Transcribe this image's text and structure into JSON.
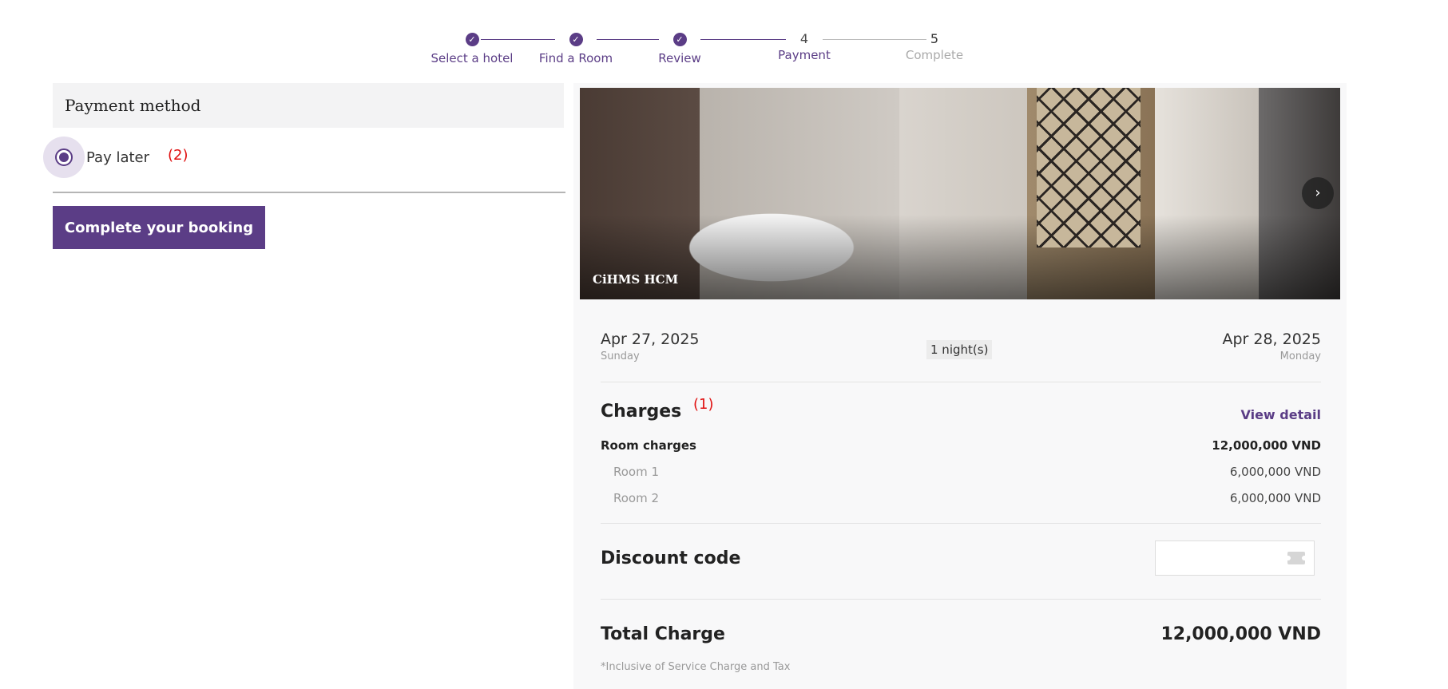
{
  "stepper": {
    "steps": [
      {
        "number": "",
        "label": "Select a hotel",
        "state": "done"
      },
      {
        "number": "",
        "label": "Find a Room",
        "state": "done"
      },
      {
        "number": "",
        "label": "Review",
        "state": "done"
      },
      {
        "number": "4",
        "label": "Payment",
        "state": "current"
      },
      {
        "number": "5",
        "label": "Complete",
        "state": "upcoming"
      }
    ]
  },
  "payment": {
    "title": "Payment method",
    "option_label": "Pay later",
    "option_selected": true,
    "annotation": "(2)",
    "button_label": "Complete your booking"
  },
  "summary": {
    "hotel_name": "CiHMS HCM",
    "check_in_date": "Apr 27, 2025",
    "check_in_day": "Sunday",
    "nights": "1 night(s)",
    "check_out_date": "Apr 28, 2025",
    "check_out_day": "Monday",
    "charges_title": "Charges",
    "charges_annotation": "(1)",
    "view_detail": "View detail",
    "room_charges_label": "Room charges",
    "room_charges_value": "12,000,000 VND",
    "rooms": [
      {
        "label": "Room 1",
        "value": "6,000,000 VND"
      },
      {
        "label": "Room 2",
        "value": "6,000,000 VND"
      }
    ],
    "discount_title": "Discount code",
    "discount_value": "",
    "total_title": "Total Charge",
    "total_value": "12,000,000 VND",
    "total_note": "*Inclusive of Service Charge and Tax"
  },
  "colors": {
    "accent": "#5b3d86",
    "annotation": "#e01010"
  }
}
